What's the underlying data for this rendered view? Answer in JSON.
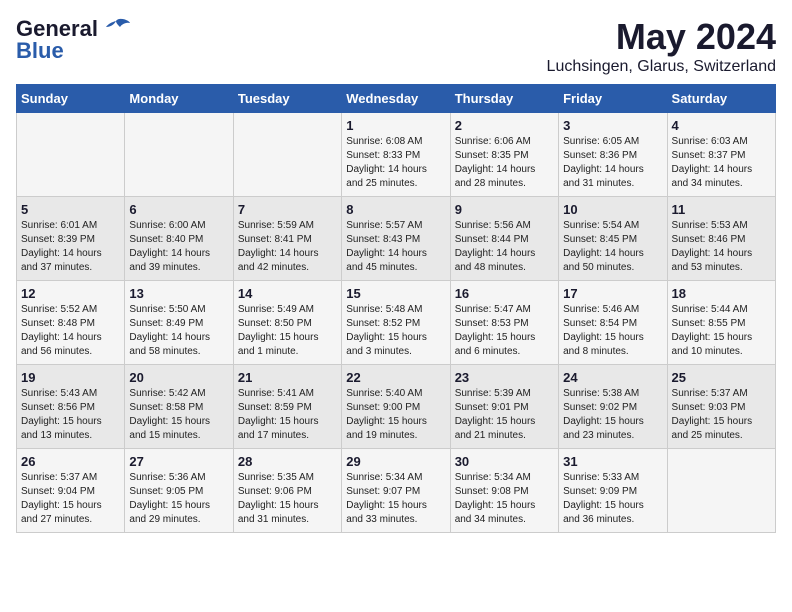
{
  "header": {
    "logo_general": "General",
    "logo_blue": "Blue",
    "title": "May 2024",
    "subtitle": "Luchsingen, Glarus, Switzerland"
  },
  "calendar": {
    "days_of_week": [
      "Sunday",
      "Monday",
      "Tuesday",
      "Wednesday",
      "Thursday",
      "Friday",
      "Saturday"
    ],
    "weeks": [
      [
        {
          "day": "",
          "info": ""
        },
        {
          "day": "",
          "info": ""
        },
        {
          "day": "",
          "info": ""
        },
        {
          "day": "1",
          "info": "Sunrise: 6:08 AM\nSunset: 8:33 PM\nDaylight: 14 hours\nand 25 minutes."
        },
        {
          "day": "2",
          "info": "Sunrise: 6:06 AM\nSunset: 8:35 PM\nDaylight: 14 hours\nand 28 minutes."
        },
        {
          "day": "3",
          "info": "Sunrise: 6:05 AM\nSunset: 8:36 PM\nDaylight: 14 hours\nand 31 minutes."
        },
        {
          "day": "4",
          "info": "Sunrise: 6:03 AM\nSunset: 8:37 PM\nDaylight: 14 hours\nand 34 minutes."
        }
      ],
      [
        {
          "day": "5",
          "info": "Sunrise: 6:01 AM\nSunset: 8:39 PM\nDaylight: 14 hours\nand 37 minutes."
        },
        {
          "day": "6",
          "info": "Sunrise: 6:00 AM\nSunset: 8:40 PM\nDaylight: 14 hours\nand 39 minutes."
        },
        {
          "day": "7",
          "info": "Sunrise: 5:59 AM\nSunset: 8:41 PM\nDaylight: 14 hours\nand 42 minutes."
        },
        {
          "day": "8",
          "info": "Sunrise: 5:57 AM\nSunset: 8:43 PM\nDaylight: 14 hours\nand 45 minutes."
        },
        {
          "day": "9",
          "info": "Sunrise: 5:56 AM\nSunset: 8:44 PM\nDaylight: 14 hours\nand 48 minutes."
        },
        {
          "day": "10",
          "info": "Sunrise: 5:54 AM\nSunset: 8:45 PM\nDaylight: 14 hours\nand 50 minutes."
        },
        {
          "day": "11",
          "info": "Sunrise: 5:53 AM\nSunset: 8:46 PM\nDaylight: 14 hours\nand 53 minutes."
        }
      ],
      [
        {
          "day": "12",
          "info": "Sunrise: 5:52 AM\nSunset: 8:48 PM\nDaylight: 14 hours\nand 56 minutes."
        },
        {
          "day": "13",
          "info": "Sunrise: 5:50 AM\nSunset: 8:49 PM\nDaylight: 14 hours\nand 58 minutes."
        },
        {
          "day": "14",
          "info": "Sunrise: 5:49 AM\nSunset: 8:50 PM\nDaylight: 15 hours\nand 1 minute."
        },
        {
          "day": "15",
          "info": "Sunrise: 5:48 AM\nSunset: 8:52 PM\nDaylight: 15 hours\nand 3 minutes."
        },
        {
          "day": "16",
          "info": "Sunrise: 5:47 AM\nSunset: 8:53 PM\nDaylight: 15 hours\nand 6 minutes."
        },
        {
          "day": "17",
          "info": "Sunrise: 5:46 AM\nSunset: 8:54 PM\nDaylight: 15 hours\nand 8 minutes."
        },
        {
          "day": "18",
          "info": "Sunrise: 5:44 AM\nSunset: 8:55 PM\nDaylight: 15 hours\nand 10 minutes."
        }
      ],
      [
        {
          "day": "19",
          "info": "Sunrise: 5:43 AM\nSunset: 8:56 PM\nDaylight: 15 hours\nand 13 minutes."
        },
        {
          "day": "20",
          "info": "Sunrise: 5:42 AM\nSunset: 8:58 PM\nDaylight: 15 hours\nand 15 minutes."
        },
        {
          "day": "21",
          "info": "Sunrise: 5:41 AM\nSunset: 8:59 PM\nDaylight: 15 hours\nand 17 minutes."
        },
        {
          "day": "22",
          "info": "Sunrise: 5:40 AM\nSunset: 9:00 PM\nDaylight: 15 hours\nand 19 minutes."
        },
        {
          "day": "23",
          "info": "Sunrise: 5:39 AM\nSunset: 9:01 PM\nDaylight: 15 hours\nand 21 minutes."
        },
        {
          "day": "24",
          "info": "Sunrise: 5:38 AM\nSunset: 9:02 PM\nDaylight: 15 hours\nand 23 minutes."
        },
        {
          "day": "25",
          "info": "Sunrise: 5:37 AM\nSunset: 9:03 PM\nDaylight: 15 hours\nand 25 minutes."
        }
      ],
      [
        {
          "day": "26",
          "info": "Sunrise: 5:37 AM\nSunset: 9:04 PM\nDaylight: 15 hours\nand 27 minutes."
        },
        {
          "day": "27",
          "info": "Sunrise: 5:36 AM\nSunset: 9:05 PM\nDaylight: 15 hours\nand 29 minutes."
        },
        {
          "day": "28",
          "info": "Sunrise: 5:35 AM\nSunset: 9:06 PM\nDaylight: 15 hours\nand 31 minutes."
        },
        {
          "day": "29",
          "info": "Sunrise: 5:34 AM\nSunset: 9:07 PM\nDaylight: 15 hours\nand 33 minutes."
        },
        {
          "day": "30",
          "info": "Sunrise: 5:34 AM\nSunset: 9:08 PM\nDaylight: 15 hours\nand 34 minutes."
        },
        {
          "day": "31",
          "info": "Sunrise: 5:33 AM\nSunset: 9:09 PM\nDaylight: 15 hours\nand 36 minutes."
        },
        {
          "day": "",
          "info": ""
        }
      ]
    ]
  }
}
